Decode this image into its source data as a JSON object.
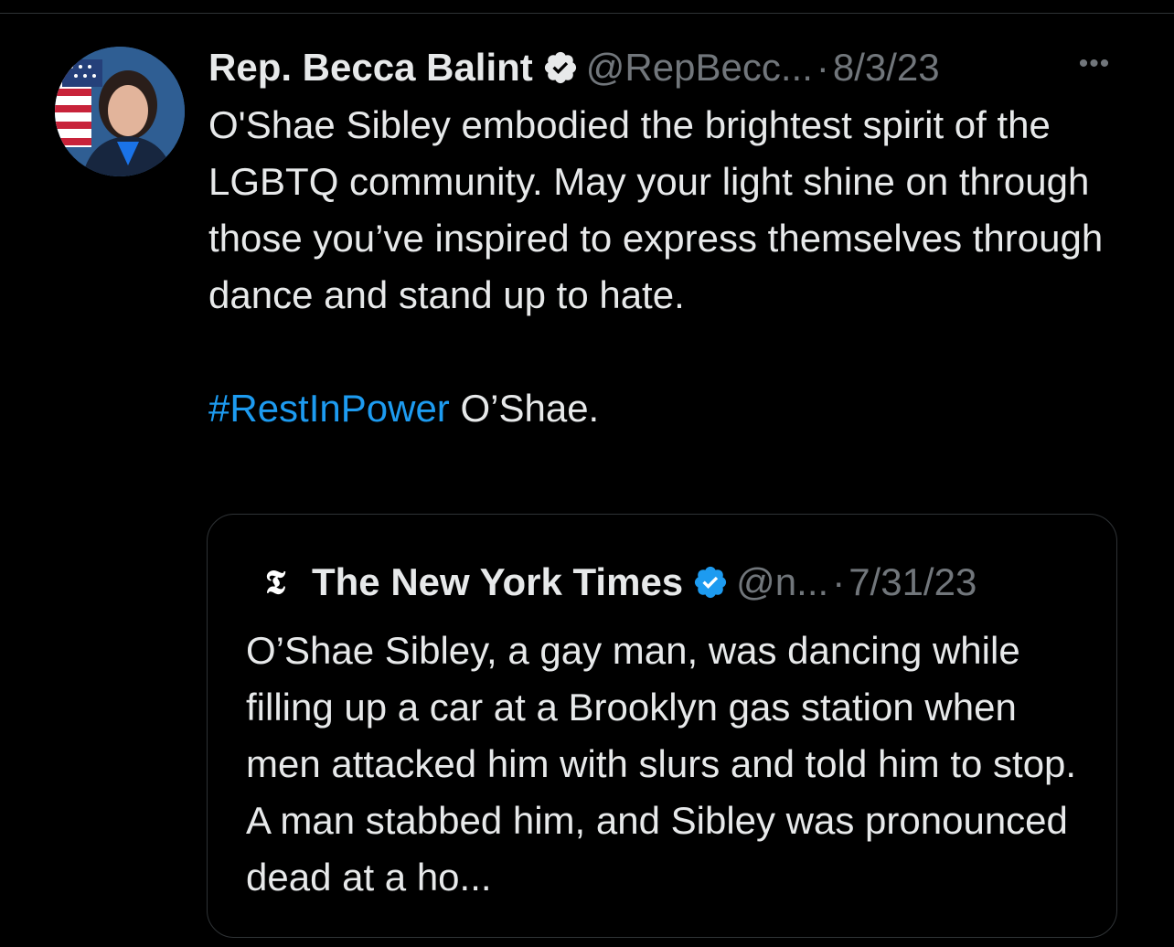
{
  "tweet": {
    "display_name": "Rep. Becca Balint",
    "handle": "@RepBecc...",
    "separator": "·",
    "timestamp": "8/3/23",
    "more_label": "•••",
    "body_lines": [
      "O'Shae Sibley embodied the brightest spirit of the LGBTQ community. May your light shine on through those you’ve inspired to express themselves through dance and stand up to hate."
    ],
    "hashtag": "#RestInPower",
    "closing": " O’Shae.",
    "verified_icon": "verified-badge-icon",
    "avatar_icon": "profile-avatar"
  },
  "quoted": {
    "logo_glyph": "𝕿",
    "display_name": "The New York Times",
    "handle": "@n...",
    "separator": "·",
    "timestamp": "7/31/23",
    "body": "O’Shae Sibley, a gay man, was dancing while filling up a car at a Brooklyn gas station when men attacked him with slurs and told him to stop. A man stabbed him, and Sibley was pronounced dead at a ho..."
  },
  "colors": {
    "background": "#000000",
    "text": "#e7e9ea",
    "secondary": "#71767b",
    "accent": "#1d9bf0",
    "border": "#2f3336"
  }
}
